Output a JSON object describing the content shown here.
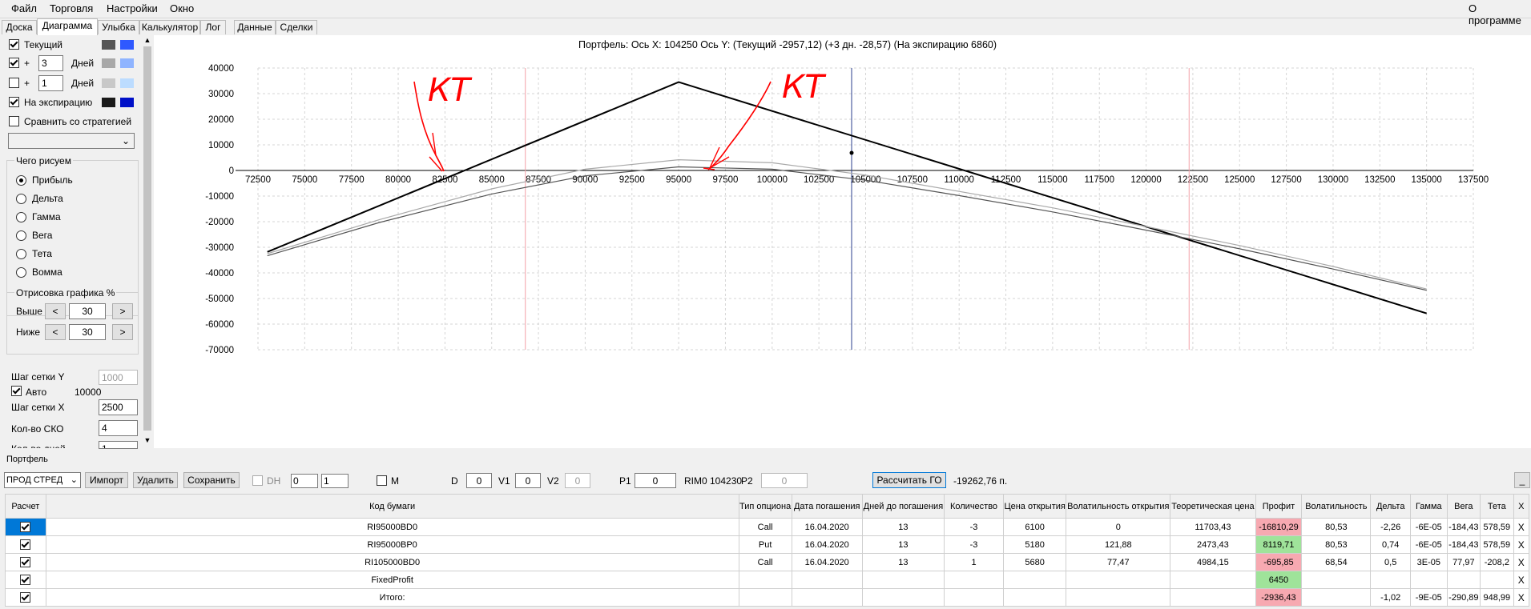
{
  "menu": {
    "file": "Файл",
    "trade": "Торговля",
    "settings": "Настройки",
    "window": "Окно",
    "about": "О программе"
  },
  "tabs": [
    "Доска",
    "Диаграмма",
    "Улыбка",
    "Калькулятор",
    "Лог",
    "Данные",
    "Сделки"
  ],
  "left": {
    "current_label": "Текущий",
    "plus": "+",
    "days_value1": "3",
    "days_value2": "1",
    "days_label": "Дней",
    "expiry_label": "На экспирацию",
    "compare_label": "Сравнить со стратегией",
    "what_label": "Чего рисуем",
    "radios": [
      "Прибыль",
      "Дельта",
      "Гамма",
      "Вега",
      "Тета",
      "Вомма"
    ],
    "draw_label": "Отрисовка графика %",
    "above_label": "Выше",
    "above_value": "30",
    "below_label": "Ниже",
    "below_value": "30",
    "lt": "<",
    "gt": ">",
    "grid_y_label": "Шаг сетки Y",
    "grid_y_value": "1000",
    "auto_label": "Авто",
    "auto_value": "10000",
    "grid_x_label": "Шаг сетки X",
    "grid_x_value": "2500",
    "sko_label": "Кол-во СКО",
    "sko_value": "4",
    "days_count_label": "Кол-во дней",
    "days_count_value": "1"
  },
  "colors": {
    "curr1": "#555555",
    "curr2": "#2f59ff",
    "d3_1": "#a8a8a8",
    "d3_2": "#8fb4ff",
    "d1_1": "#c8c8c8",
    "d1_2": "#bcdcff",
    "exp1": "#1a1a1a",
    "exp2": "#0010c8",
    "annot": "#ff0000"
  },
  "chart_data": {
    "type": "line",
    "title": "Портфель: Ось X: 104250 Ось Y:  (Текущий -2957,12)  (+3 дн. -28,57)  (На экспирацию 6860)",
    "xlim": [
      72500,
      137500
    ],
    "ylim": [
      -70000,
      40000
    ],
    "x_ticks": [
      "72500",
      "75000",
      "77500",
      "80000",
      "82500",
      "85000",
      "87500",
      "90000",
      "92500",
      "95000",
      "97500",
      "100000",
      "102500",
      "105000",
      "107500",
      "110000",
      "112500",
      "115000",
      "117500",
      "120000",
      "122500",
      "125000",
      "127500",
      "130000",
      "132500",
      "135000",
      "137500"
    ],
    "y_ticks": [
      "40000",
      "30000",
      "20000",
      "10000",
      "0",
      "-10000",
      "-20000",
      "-30000",
      "-40000",
      "-50000",
      "-60000",
      "-70000"
    ],
    "vlines": [
      {
        "x": 86800,
        "color": "#f4a0a8"
      },
      {
        "x": 104250,
        "color": "#2b3f8f"
      },
      {
        "x": 122300,
        "color": "#f4a0a8"
      }
    ],
    "series": [
      {
        "points": [
          [
            73000,
            -31800
          ],
          [
            95000,
            34500
          ],
          [
            135000,
            -55800
          ]
        ],
        "color": "#000000"
      },
      {
        "points": [
          [
            73000,
            -32500
          ],
          [
            79000,
            -19200
          ],
          [
            85000,
            -7200
          ],
          [
            90000,
            500
          ],
          [
            95000,
            4200
          ],
          [
            100000,
            3000
          ],
          [
            105000,
            -1800
          ],
          [
            110000,
            -8200
          ],
          [
            115000,
            -14600
          ],
          [
            120000,
            -21900
          ],
          [
            125000,
            -29300
          ],
          [
            130000,
            -37500
          ],
          [
            135000,
            -46300
          ]
        ],
        "color": "#a8a8a8"
      },
      {
        "points": [
          [
            73000,
            -33300
          ],
          [
            79000,
            -20300
          ],
          [
            85000,
            -9200
          ],
          [
            90000,
            -2100
          ],
          [
            95000,
            1400
          ],
          [
            100000,
            500
          ],
          [
            105000,
            -3800
          ],
          [
            110000,
            -9800
          ],
          [
            115000,
            -16200
          ],
          [
            120000,
            -23300
          ],
          [
            125000,
            -30600
          ],
          [
            130000,
            -38500
          ],
          [
            135000,
            -46800
          ]
        ],
        "color": "#555555"
      }
    ],
    "current_point": [
      104250,
      6860
    ],
    "annotations": [
      "КТ",
      "КТ"
    ]
  },
  "portfolio": {
    "label": "Портфель",
    "strategy": "ПРОД СТРЕД",
    "import": "Импорт",
    "delete": "Удалить",
    "save": "Сохранить",
    "dh": "DH",
    "sp1": "0",
    "sp2": "1",
    "m": "M",
    "d": "D",
    "d_value": "0",
    "v1": "V1",
    "v1_value": "0",
    "v2": "V2",
    "v2_value": "0",
    "p1": "P1",
    "p1_value": "0",
    "rim": "RIM0 104230",
    "p2": "P2",
    "p2_value": "0",
    "calc": "Рассчитать ГО",
    "go_value": "-19262,76 п.",
    "minimize": "_"
  },
  "table": {
    "headers": [
      "Расчет",
      "Код бумаги",
      "Тип опциона",
      "Дата погашения",
      "Дней до погашения",
      "Количество",
      "Цена открытия",
      "Волатильность открытия",
      "Теоретическая цена",
      "Профит",
      "Волатильность",
      "Дельта",
      "Гамма",
      "Вега",
      "Тета",
      "X"
    ],
    "rows": [
      [
        "RI95000BD0",
        "Call",
        "16.04.2020",
        "13",
        "-3",
        "6100",
        "0",
        "11703,43",
        "-16810,29",
        "80,53",
        "-2,26",
        "-6E-05",
        "-184,43",
        "578,59",
        "X"
      ],
      [
        "RI95000BP0",
        "Put",
        "16.04.2020",
        "13",
        "-3",
        "5180",
        "121,88",
        "2473,43",
        "8119,71",
        "80,53",
        "0,74",
        "-6E-05",
        "-184,43",
        "578,59",
        "X"
      ],
      [
        "RI105000BD0",
        "Call",
        "16.04.2020",
        "13",
        "1",
        "5680",
        "77,47",
        "4984,15",
        "-695,85",
        "68,54",
        "0,5",
        "3E-05",
        "77,97",
        "-208,2",
        "X"
      ],
      [
        "FixedProfit",
        "",
        "",
        "",
        "",
        "",
        "",
        "",
        "6450",
        "",
        "",
        "",
        "",
        "",
        "X"
      ]
    ],
    "total": [
      "Итого:",
      "-2936,43",
      "-1,02",
      "-9E-05",
      "-290,89",
      "948,99",
      "X"
    ]
  }
}
